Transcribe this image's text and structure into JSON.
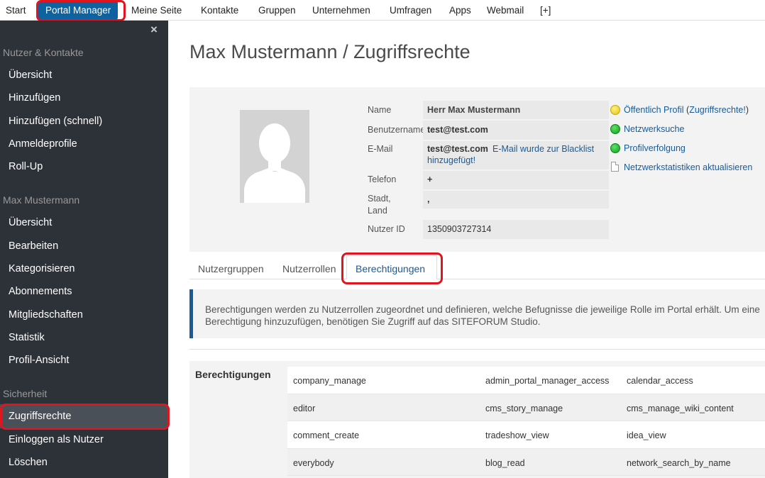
{
  "topnav": {
    "items": [
      "Start",
      "Portal Manager",
      "Meine Seite",
      "Kontakte",
      "Gruppen",
      "Unternehmen",
      "Umfragen",
      "Apps",
      "Webmail",
      "[+]"
    ]
  },
  "sidebar": {
    "close": "×",
    "sections": [
      "Nutzer & Kontakte",
      "Max Mustermann",
      "Sicherheit"
    ],
    "group1": [
      "Übersicht",
      "Hinzufügen",
      "Hinzufügen (schnell)",
      "Anmeldeprofile",
      "Roll-Up"
    ],
    "group2": [
      "Übersicht",
      "Bearbeiten",
      "Kategorisieren",
      "Abonnements",
      "Mitgliedschaften",
      "Statistik",
      "Profil-Ansicht"
    ],
    "group3": [
      "Zugriffsrechte",
      "Einloggen als Nutzer",
      "Löschen"
    ]
  },
  "page": {
    "title": "Max Mustermann / Zugriffsrechte"
  },
  "profile": {
    "labels": {
      "name": "Name",
      "username": "Benutzername",
      "email": "E-Mail",
      "phone": "Telefon",
      "city": "Stadt, Land",
      "userid": "Nutzer ID"
    },
    "values": {
      "name": "Herr Max Mustermann",
      "username": "test@test.com",
      "email": "test@test.com",
      "email_note_1": "E-Mail wurde zur Blacklist",
      "email_note_2": "hinzugefügt!",
      "phone": "+",
      "city": ",",
      "userid": "1350903727314"
    },
    "side_links": {
      "public_profile": "Öffentlich Profil",
      "access_rights": "Zugriffsrechte!",
      "network_search": "Netzwerksuche",
      "profile_tracking": "Profilverfolgung",
      "update_stats": "Netzwerkstatistiken aktualisieren"
    }
  },
  "tabs": [
    "Nutzergruppen",
    "Nutzerrollen",
    "Berechtigungen"
  ],
  "info": {
    "text": "Berechtigungen werden zu Nutzerrollen zugeordnet und definieren, welche Befugnisse die jeweilige Rolle im Portal erhält. Um eine Berechtigung hinzuzufügen, benötigen Sie Zugriff auf das SITEFORUM Studio."
  },
  "permissions": {
    "title": "Berechtigungen",
    "rows": [
      [
        "company_manage",
        "admin_portal_manager_access",
        "calendar_access"
      ],
      [
        "editor",
        "cms_story_manage",
        "cms_manage_wiki_content"
      ],
      [
        "comment_create",
        "tradeshow_view",
        "idea_view"
      ],
      [
        "everybody",
        "blog_read",
        "network_search_by_name"
      ]
    ]
  },
  "colors": {
    "nav_active": "#0f62a0",
    "sidebar_bg": "#2d3238",
    "link": "#1a5b96",
    "highlight": "#e0151d"
  }
}
